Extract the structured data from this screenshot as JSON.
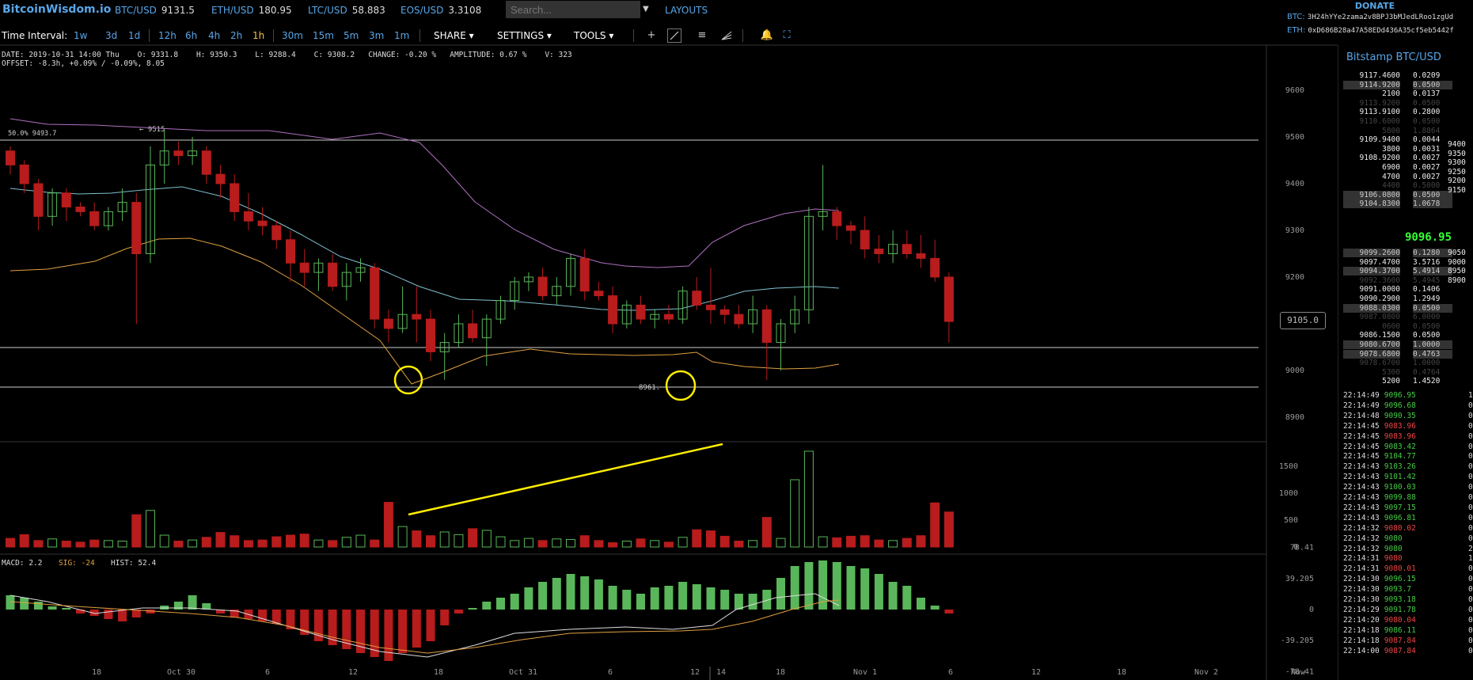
{
  "topbar": {
    "logo": "BitcoinWisdom.io",
    "tickers": [
      {
        "sym": "BTC/USD",
        "val": "9131.5"
      },
      {
        "sym": "ETH/USD",
        "val": "180.95"
      },
      {
        "sym": "LTC/USD",
        "val": "58.883"
      },
      {
        "sym": "EOS/USD",
        "val": "3.3108"
      }
    ],
    "search_placeholder": "Search...",
    "layouts": "LAYOUTS"
  },
  "donate": {
    "title": "DONATE",
    "btc_label": "BTC:",
    "btc_addr": "3H24hYYe2zama2v8BPJ3bMJedLRoo1zgUd",
    "eth_label": "ETH:",
    "eth_addr": "0xD686B28a47A58EDd436A35cf5eb5442f"
  },
  "toolbar": {
    "label": "Time Interval:",
    "intervals": [
      "1w",
      "3d",
      "1d",
      "12h",
      "6h",
      "4h",
      "2h",
      "1h",
      "30m",
      "15m",
      "5m",
      "3m",
      "1m"
    ],
    "active_interval": "1h",
    "share": "SHARE",
    "settings": "SETTINGS",
    "tools": "TOOLS"
  },
  "info": {
    "line1": "DATE: 2019-10-31 14:00 Thu    O: 9331.8    H: 9350.3    L: 9288.4    C: 9308.2   CHANGE: -0.20 %   AMPLITUDE: 0.67 %    V: 323",
    "line2": "OFFSET: -8.3h, +0.09% / -0.09%, 8.05"
  },
  "chart": {
    "price_axis": [
      "9600",
      "9500",
      "9400",
      "9300",
      "9200",
      "9100",
      "9000",
      "8900"
    ],
    "volume_axis": [
      "1500",
      "1000",
      "500",
      "0"
    ],
    "macd_axis": [
      "78.41",
      "39.205",
      "0",
      "-39.205",
      "-78.41"
    ],
    "x_axis": [
      "18",
      "Oct 30",
      "6",
      "12",
      "18",
      "Oct 31",
      "6",
      "12",
      "14",
      "18",
      "Nov 1",
      "6",
      "12",
      "18",
      "Nov 2",
      "Now"
    ],
    "fib_label": "50.0% 9493.7",
    "high_label": "← 9515",
    "low_label": "8961.",
    "current_price": "9105.0",
    "macd_label": "MACD: 2.2",
    "sig_label": "SIG: -24",
    "hist_label": "HIST: 52.4",
    "colors": {
      "up": "#5ab65a",
      "down": "#b81c1c",
      "annotation": "#ffee00",
      "upper_band": "#b070c0",
      "mid_band": "#7fbfd0",
      "lower_band": "#e0a040"
    }
  },
  "chart_data": {
    "type": "candlestick",
    "interval": "1h",
    "candles": [
      [
        9470,
        9480,
        9420,
        9440
      ],
      [
        9440,
        9450,
        9380,
        9400
      ],
      [
        9400,
        9410,
        9300,
        9330
      ],
      [
        9330,
        9390,
        9310,
        9380
      ],
      [
        9380,
        9390,
        9320,
        9350
      ],
      [
        9350,
        9360,
        9330,
        9340
      ],
      [
        9340,
        9360,
        9300,
        9310
      ],
      [
        9310,
        9350,
        9300,
        9340
      ],
      [
        9340,
        9390,
        9320,
        9360
      ],
      [
        9360,
        9380,
        9100,
        9250
      ],
      [
        9250,
        9480,
        9230,
        9440
      ],
      [
        9440,
        9515,
        9400,
        9470
      ],
      [
        9470,
        9490,
        9440,
        9460
      ],
      [
        9460,
        9500,
        9440,
        9470
      ],
      [
        9470,
        9480,
        9400,
        9420
      ],
      [
        9420,
        9440,
        9370,
        9400
      ],
      [
        9400,
        9420,
        9320,
        9340
      ],
      [
        9340,
        9380,
        9300,
        9320
      ],
      [
        9320,
        9350,
        9290,
        9310
      ],
      [
        9310,
        9320,
        9260,
        9280
      ],
      [
        9280,
        9300,
        9190,
        9230
      ],
      [
        9230,
        9260,
        9180,
        9210
      ],
      [
        9210,
        9240,
        9170,
        9230
      ],
      [
        9230,
        9250,
        9170,
        9180
      ],
      [
        9180,
        9230,
        9150,
        9210
      ],
      [
        9210,
        9240,
        9190,
        9220
      ],
      [
        9220,
        9230,
        9090,
        9110
      ],
      [
        9110,
        9130,
        9060,
        9090
      ],
      [
        9090,
        9180,
        9080,
        9120
      ],
      [
        9120,
        9180,
        9060,
        9110
      ],
      [
        9110,
        9130,
        9020,
        9040
      ],
      [
        9040,
        9080,
        8980,
        9060
      ],
      [
        9060,
        9120,
        9050,
        9100
      ],
      [
        9100,
        9130,
        9060,
        9070
      ],
      [
        9070,
        9120,
        9010,
        9110
      ],
      [
        9110,
        9160,
        9100,
        9150
      ],
      [
        9150,
        9200,
        9130,
        9190
      ],
      [
        9190,
        9210,
        9170,
        9200
      ],
      [
        9200,
        9220,
        9150,
        9160
      ],
      [
        9160,
        9200,
        9140,
        9180
      ],
      [
        9180,
        9250,
        9160,
        9240
      ],
      [
        9240,
        9260,
        9150,
        9170
      ],
      [
        9170,
        9190,
        9150,
        9160
      ],
      [
        9160,
        9180,
        9080,
        9100
      ],
      [
        9100,
        9150,
        9090,
        9140
      ],
      [
        9140,
        9160,
        9100,
        9110
      ],
      [
        9110,
        9130,
        9090,
        9120
      ],
      [
        9120,
        9140,
        9100,
        9110
      ],
      [
        9110,
        9180,
        9100,
        9170
      ],
      [
        9170,
        9200,
        9130,
        9140
      ],
      [
        9140,
        9220,
        9100,
        9130
      ],
      [
        9130,
        9140,
        9100,
        9120
      ],
      [
        9120,
        9140,
        9090,
        9100
      ],
      [
        9100,
        9160,
        9080,
        9130
      ],
      [
        9130,
        9140,
        8980,
        9060
      ],
      [
        9060,
        9110,
        9000,
        9100
      ],
      [
        9100,
        9160,
        9080,
        9130
      ],
      [
        9130,
        9350,
        9100,
        9330
      ],
      [
        9330,
        9440,
        9300,
        9340
      ],
      [
        9340,
        9350,
        9280,
        9310
      ],
      [
        9310,
        9320,
        9270,
        9300
      ],
      [
        9300,
        9330,
        9240,
        9260
      ],
      [
        9260,
        9290,
        9230,
        9250
      ],
      [
        9250,
        9300,
        9230,
        9270
      ],
      [
        9270,
        9300,
        9240,
        9250
      ],
      [
        9250,
        9290,
        9220,
        9240
      ],
      [
        9240,
        9280,
        9190,
        9200
      ],
      [
        9200,
        9210,
        9060,
        9105
      ]
    ],
    "volume": [
      160,
      230,
      120,
      150,
      110,
      90,
      130,
      120,
      110,
      600,
      680,
      220,
      110,
      130,
      180,
      270,
      210,
      120,
      130,
      190,
      220,
      240,
      130,
      120,
      180,
      220,
      130,
      830,
      380,
      300,
      210,
      280,
      230,
      340,
      310,
      190,
      120,
      160,
      120,
      150,
      140,
      210,
      120,
      80,
      110,
      150,
      120,
      90,
      180,
      320,
      300,
      200,
      110,
      120,
      550,
      160,
      1250,
      1780,
      190,
      170,
      200,
      210,
      130,
      120,
      160,
      210,
      820,
      650
    ],
    "macd": {
      "hist": [
        18,
        15,
        10,
        4,
        2,
        -5,
        -8,
        -12,
        -15,
        -10,
        -5,
        5,
        10,
        18,
        8,
        -5,
        -10,
        -12,
        -15,
        -18,
        -25,
        -32,
        -40,
        -45,
        -50,
        -55,
        -60,
        -65,
        -55,
        -48,
        -40,
        -20,
        -5,
        2,
        10,
        15,
        20,
        28,
        35,
        40,
        45,
        42,
        38,
        30,
        25,
        20,
        28,
        30,
        35,
        32,
        28,
        25,
        20,
        20,
        25,
        40,
        55,
        60,
        62,
        60,
        55,
        52,
        45,
        35,
        30,
        15,
        5,
        -5
      ]
    }
  },
  "right_panel": {
    "title": "Bitstamp BTC/USD",
    "asks": [
      {
        "p": "9117.46",
        "pd": "00",
        "s": "0.0209",
        "style": "normal"
      },
      {
        "p": "9114.92",
        "pd": "00",
        "s": "0.0500",
        "style": "hl"
      },
      {
        "p": "21",
        "pd": "00",
        "s": "0.0137",
        "style": "normal"
      },
      {
        "p": "9113.92",
        "pd": "00",
        "s": "0.0500",
        "style": "dim"
      },
      {
        "p": "9113.91",
        "pd": "00",
        "s": "0.2800",
        "style": "normal"
      },
      {
        "p": "9110.60",
        "pd": "00",
        "s": "0.0500",
        "style": "dim"
      },
      {
        "p": "5800",
        "pd": "",
        "s": "1.8864",
        "style": "dim"
      },
      {
        "p": "9109.94",
        "pd": "00",
        "s": "0.0044",
        "style": "normal"
      },
      {
        "p": "38",
        "pd": "00",
        "s": "0.0031",
        "style": "normal"
      },
      {
        "p": "9108.92",
        "pd": "00",
        "s": "0.0027",
        "style": "normal"
      },
      {
        "p": "69",
        "pd": "00",
        "s": "0.0027",
        "style": "normal"
      },
      {
        "p": "47",
        "pd": "00",
        "s": "0.0027",
        "style": "normal"
      },
      {
        "p": "4400",
        "pd": "",
        "s": "0.5000",
        "style": "dim"
      },
      {
        "p": "9106.08",
        "pd": "00",
        "s": "0.0500",
        "style": "hl"
      },
      {
        "p": "9104.83",
        "pd": "00",
        "s": "1.0678",
        "style": "hl"
      }
    ],
    "last_price": "9096.95",
    "bids": [
      {
        "p": "9099.26",
        "pd": "00",
        "s": "0.1280",
        "style": "hl"
      },
      {
        "p": "9097.47",
        "pd": "00",
        "s": "3.5716",
        "style": "normal"
      },
      {
        "p": "9094.37",
        "pd": "00",
        "s": "5.4914",
        "style": "hl"
      },
      {
        "p": "9092.3600",
        "pd": "",
        "s": "5.4945",
        "style": "dim"
      },
      {
        "p": "9091.0",
        "pd": "000",
        "s": "0.1406",
        "style": "normal"
      },
      {
        "p": "9090.29",
        "pd": "00",
        "s": "1.2949",
        "style": "normal"
      },
      {
        "p": "9088.03",
        "pd": "00",
        "s": "0.0500",
        "style": "hl"
      },
      {
        "p": "9087.0800",
        "pd": "",
        "s": "6.0000",
        "style": "dim"
      },
      {
        "p": "0600",
        "pd": "",
        "s": "0.0500",
        "style": "dim"
      },
      {
        "p": "9086.15",
        "pd": "00",
        "s": "0.0500",
        "style": "normal"
      },
      {
        "p": "9080.67",
        "pd": "00",
        "s": "1.0000",
        "style": "hl"
      },
      {
        "p": "9078.68",
        "pd": "00",
        "s": "0.4763",
        "style": "hl"
      },
      {
        "p": "9078.6700",
        "pd": "",
        "s": "1.0000",
        "style": "dim"
      },
      {
        "p": "5300",
        "pd": "",
        "s": "0.4764",
        "style": "dim"
      },
      {
        "p": "5200",
        "pd": "",
        "s": "1.4520",
        "style": "normal"
      }
    ],
    "ask_depth": [
      "9400",
      "9350",
      "9300",
      "9250",
      "9200",
      "9150"
    ],
    "bid_depth": [
      "9050",
      "9000",
      "8950",
      "8900"
    ],
    "trades": [
      {
        "t": "22:14:49",
        "p": "9096.95",
        "d": "up",
        "a": "1."
      },
      {
        "t": "22:14:49",
        "p": "9096.68",
        "d": "up",
        "a": "0."
      },
      {
        "t": "22:14:48",
        "p": "9090.35",
        "d": "up",
        "a": "0."
      },
      {
        "t": "22:14:45",
        "p": "9083.96",
        "d": "dn",
        "a": "0."
      },
      {
        "t": "22:14:45",
        "p": "9083.96",
        "d": "dn",
        "a": "0."
      },
      {
        "t": "22:14:45",
        "p": "9083.42",
        "d": "up",
        "a": "0."
      },
      {
        "t": "22:14:45",
        "p": "9104.77",
        "d": "up",
        "a": "0."
      },
      {
        "t": "22:14:43",
        "p": "9103.26",
        "d": "up",
        "a": "0."
      },
      {
        "t": "22:14:43",
        "p": "9101.42",
        "d": "up",
        "a": "0."
      },
      {
        "t": "22:14:43",
        "p": "9100.03",
        "d": "up",
        "a": "0."
      },
      {
        "t": "22:14:43",
        "p": "9099.88",
        "d": "up",
        "a": "0."
      },
      {
        "t": "22:14:43",
        "p": "9097.15",
        "d": "up",
        "a": "0."
      },
      {
        "t": "22:14:43",
        "p": "9096.81",
        "d": "up",
        "a": "0."
      },
      {
        "t": "22:14:32",
        "p": "9080.02",
        "d": "dn",
        "a": "0."
      },
      {
        "t": "22:14:32",
        "p": "9080",
        "d": "up",
        "a": "0."
      },
      {
        "t": "22:14:32",
        "p": "9080",
        "d": "up",
        "a": "29."
      },
      {
        "t": "22:14:31",
        "p": "9080",
        "d": "dn",
        "a": "18."
      },
      {
        "t": "22:14:31",
        "p": "9080.01",
        "d": "dn",
        "a": "0."
      },
      {
        "t": "22:14:30",
        "p": "9096.15",
        "d": "up",
        "a": "0."
      },
      {
        "t": "22:14:30",
        "p": "9093.7",
        "d": "up",
        "a": "0."
      },
      {
        "t": "22:14:30",
        "p": "9093.18",
        "d": "up",
        "a": "0."
      },
      {
        "t": "22:14:29",
        "p": "9091.78",
        "d": "up",
        "a": "0."
      },
      {
        "t": "22:14:20",
        "p": "9080.04",
        "d": "dn",
        "a": "0."
      },
      {
        "t": "22:14:18",
        "p": "9086.11",
        "d": "up",
        "a": "0."
      },
      {
        "t": "22:14:18",
        "p": "9087.84",
        "d": "dn",
        "a": "0."
      },
      {
        "t": "22:14:00",
        "p": "9087.84",
        "d": "dn",
        "a": "0."
      }
    ]
  }
}
